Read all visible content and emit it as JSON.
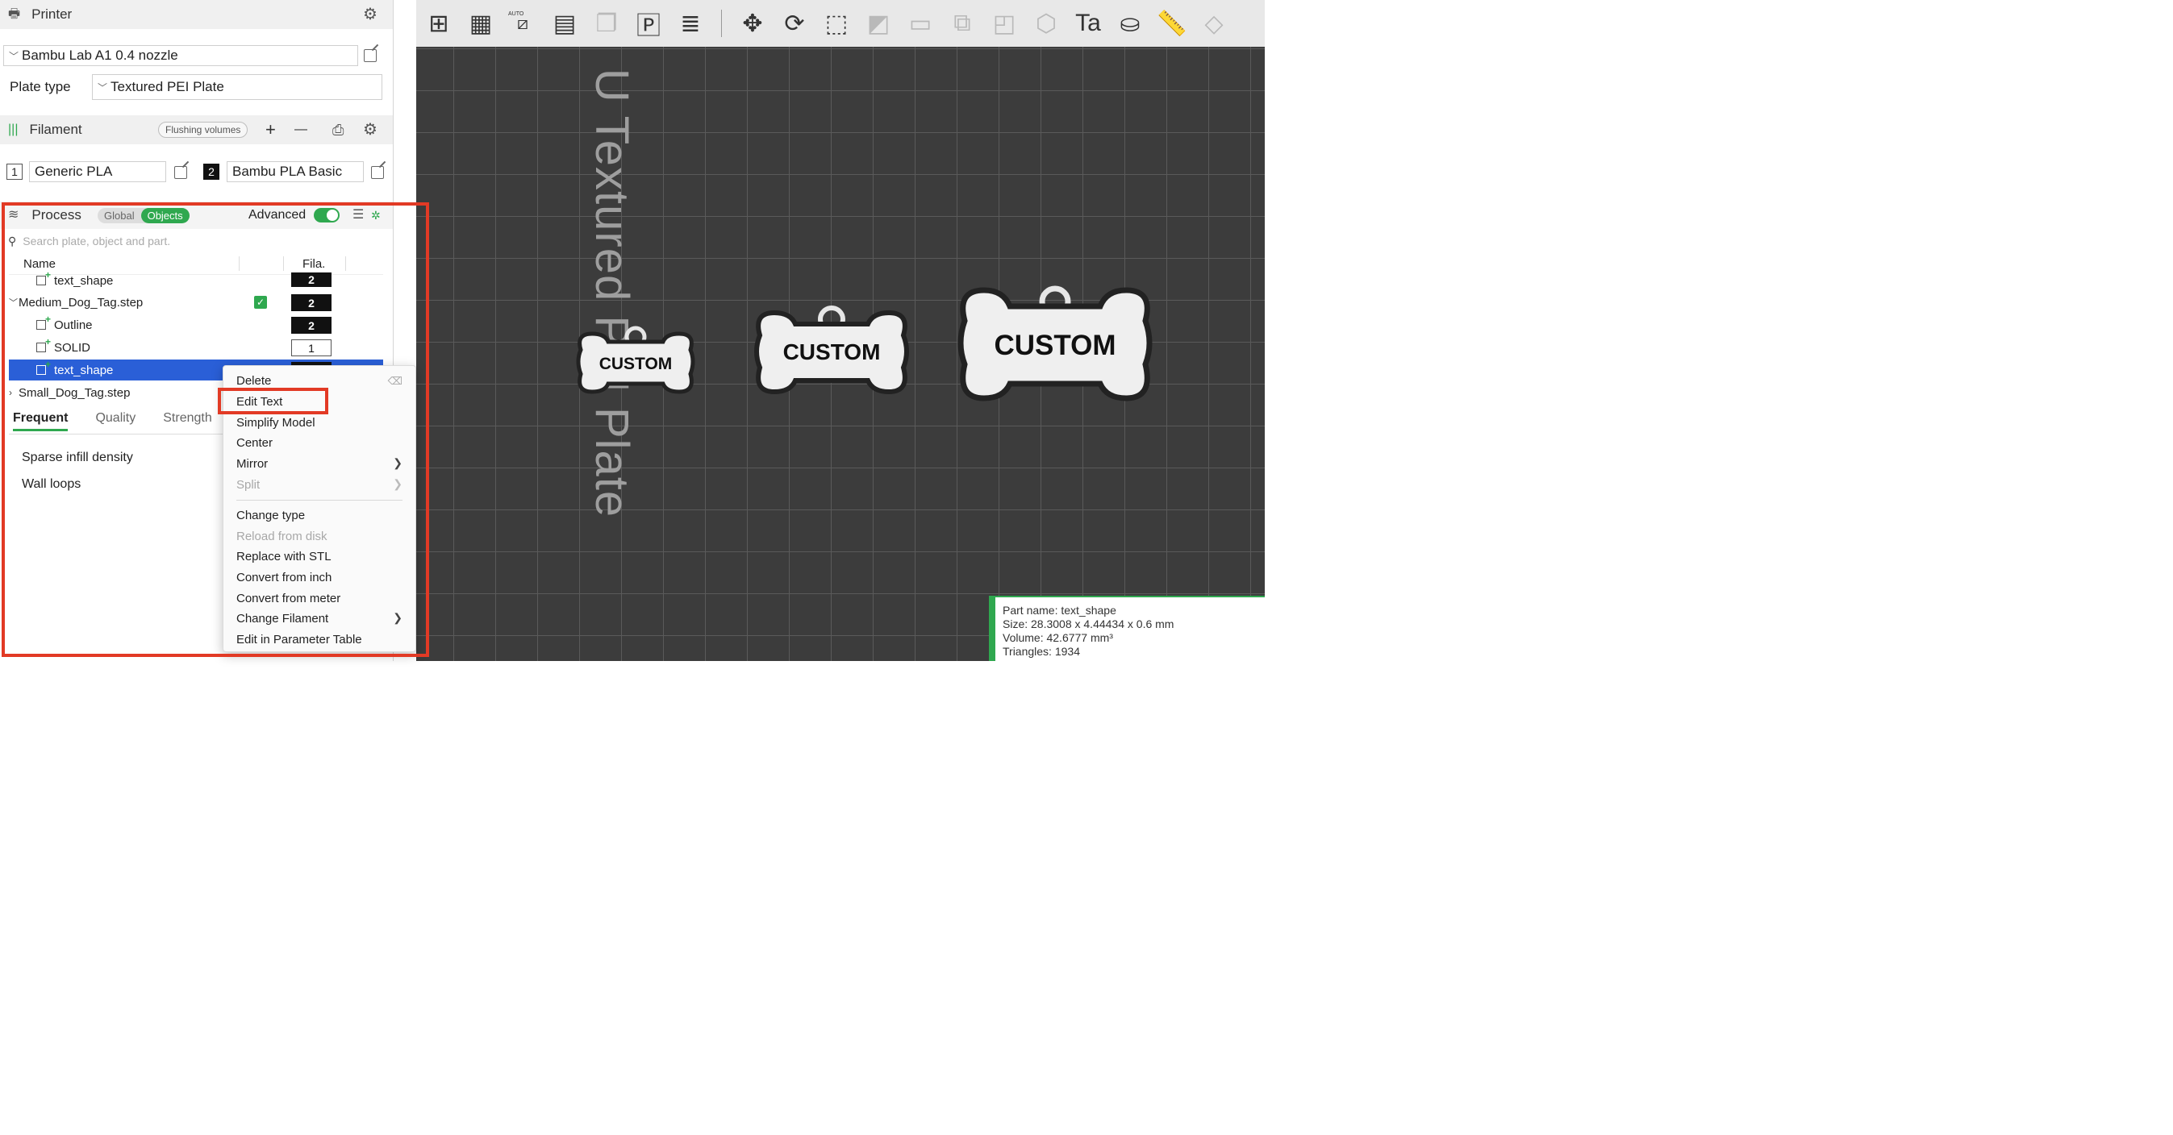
{
  "printer": {
    "title": "Printer",
    "preset": "Bambu Lab A1 0.4 nozzle",
    "plate_type_label": "Plate type",
    "plate_type_value": "Textured PEI Plate"
  },
  "filament": {
    "title": "Filament",
    "flushing_label": "Flushing volumes",
    "add_symbol": "+",
    "remove_symbol": "—",
    "slots": [
      {
        "num": "1",
        "name": "Generic PLA"
      },
      {
        "num": "2",
        "name": "Bambu PLA Basic"
      }
    ]
  },
  "process": {
    "title": "Process",
    "mode_global": "Global",
    "mode_objects": "Objects",
    "advanced_label": "Advanced",
    "search_placeholder": "Search plate, object and part."
  },
  "object_list": {
    "col_name": "Name",
    "col_fila": "Fila.",
    "rows": [
      {
        "name": "text_shape",
        "fila": "2"
      },
      {
        "name": "Medium_Dog_Tag.step",
        "fila": "2"
      },
      {
        "name": "Outline",
        "fila": "2"
      },
      {
        "name": "SOLID",
        "fila": "1"
      },
      {
        "name": "text_shape",
        "fila": ""
      },
      {
        "name": "Small_Dog_Tag.step",
        "fila": ""
      }
    ]
  },
  "settings_tabs": [
    "Frequent",
    "Quality",
    "Strength"
  ],
  "settings": [
    "Sparse infill density",
    "Wall loops"
  ],
  "context_menu": {
    "items": [
      {
        "label": "Delete"
      },
      {
        "label": "Edit Text"
      },
      {
        "label": "Simplify Model"
      },
      {
        "label": "Center"
      },
      {
        "label": "Mirror"
      },
      {
        "label": "Split"
      },
      {
        "label": "Change type"
      },
      {
        "label": "Reload from disk"
      },
      {
        "label": "Replace with STL"
      },
      {
        "label": "Convert from inch"
      },
      {
        "label": "Convert from meter"
      },
      {
        "label": "Change Filament"
      },
      {
        "label": "Edit in Parameter Table"
      }
    ]
  },
  "viewport": {
    "plate_label": "U Textured PEI Plate",
    "tag_text": "CUSTOM",
    "toolbar_auto": "AUTO"
  },
  "part_info": {
    "name": "Part name: text_shape",
    "size": "Size: 28.3008 x 4.44434 x 0.6 mm",
    "volume": "Volume: 42.6777 mm³",
    "triangles": "Triangles: 1934"
  },
  "colors": {
    "accent_green": "#2fa84f",
    "selection_blue": "#2a5fd7",
    "highlight_red": "#e23a25",
    "viewport_bg": "#3c3c3c"
  }
}
